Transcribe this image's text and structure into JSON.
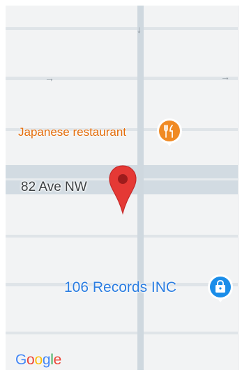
{
  "map": {
    "street_label": "82 Ave NW",
    "pois": [
      {
        "name": "Japanese restaurant",
        "icon": "restaurant-icon",
        "color": "#f08a24"
      },
      {
        "name": "106 Records INC",
        "icon": "shopping-bag-icon",
        "color": "#1a8de9"
      }
    ],
    "pin": {
      "icon": "map-pin-icon",
      "color": "#e53935"
    },
    "logo": {
      "letters": [
        "G",
        "o",
        "o",
        "g",
        "l",
        "e"
      ],
      "colors": [
        "#4285f4",
        "#ea4335",
        "#fbbc05",
        "#4285f4",
        "#34a853",
        "#ea4335"
      ]
    }
  }
}
